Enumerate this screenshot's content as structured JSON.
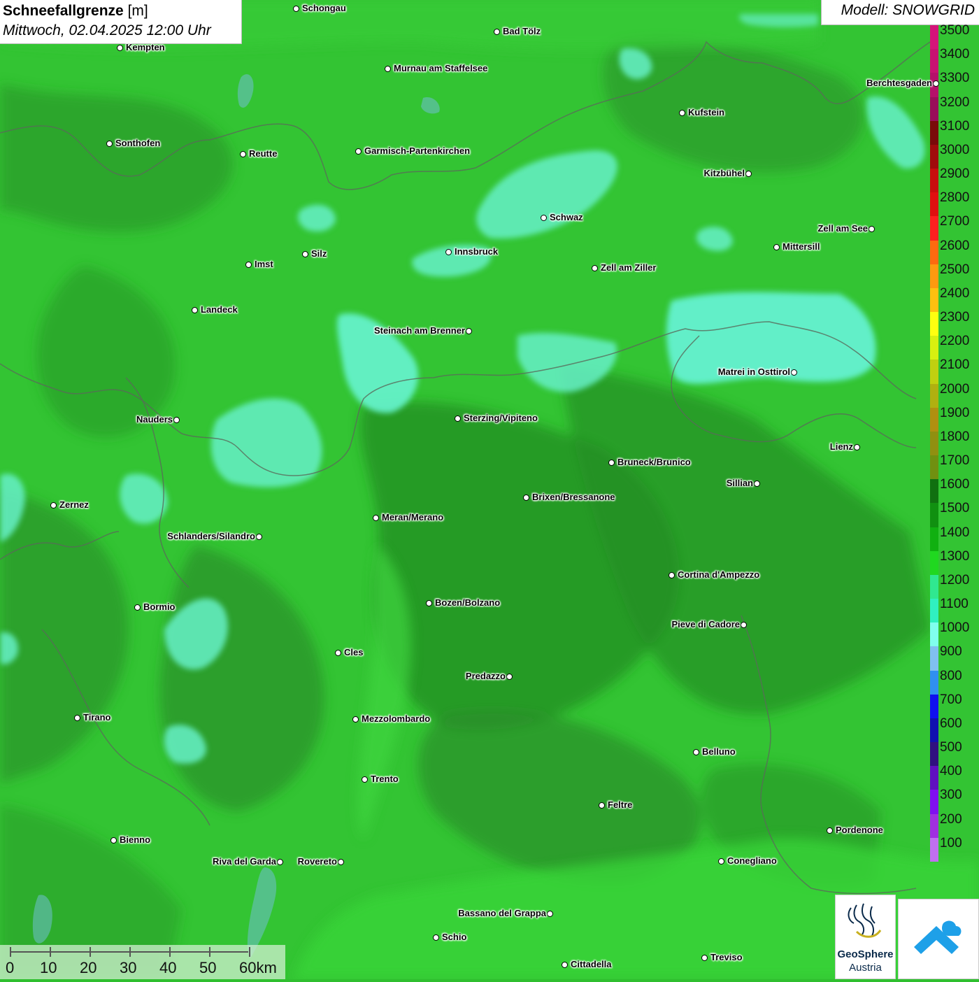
{
  "header": {
    "title_bold": "Schneefallgrenze",
    "title_unit": "[m]",
    "datetime": "Mittwoch, 02.04.2025 12:00 Uhr",
    "model": "Modell: SNOWGRID"
  },
  "legend": {
    "levels": [
      {
        "label": "3500",
        "color": "#d4147a"
      },
      {
        "label": "3400",
        "color": "#c81272"
      },
      {
        "label": "3300",
        "color": "#b5106a"
      },
      {
        "label": "3200",
        "color": "#9a0e5a"
      },
      {
        "label": "3100",
        "color": "#7a0a0a"
      },
      {
        "label": "3000",
        "color": "#a00c0c"
      },
      {
        "label": "2900",
        "color": "#c80e0e"
      },
      {
        "label": "2800",
        "color": "#e01010"
      },
      {
        "label": "2700",
        "color": "#ff2020"
      },
      {
        "label": "2600",
        "color": "#ff6a10"
      },
      {
        "label": "2500",
        "color": "#ff9a10"
      },
      {
        "label": "2400",
        "color": "#ffc010"
      },
      {
        "label": "2300",
        "color": "#ffff10"
      },
      {
        "label": "2200",
        "color": "#d8f010"
      },
      {
        "label": "2100",
        "color": "#c0d010"
      },
      {
        "label": "2000",
        "color": "#b0b010"
      },
      {
        "label": "1900",
        "color": "#b09010"
      },
      {
        "label": "1800",
        "color": "#909010"
      },
      {
        "label": "1700",
        "color": "#709010"
      },
      {
        "label": "1600",
        "color": "#107010"
      },
      {
        "label": "1500",
        "color": "#109010"
      },
      {
        "label": "1400",
        "color": "#10b010"
      },
      {
        "label": "1300",
        "color": "#20d820"
      },
      {
        "label": "1200",
        "color": "#30e890"
      },
      {
        "label": "1100",
        "color": "#30f0c0"
      },
      {
        "label": "1000",
        "color": "#80ffee"
      },
      {
        "label": "900",
        "color": "#80c0f0"
      },
      {
        "label": "800",
        "color": "#3090f0"
      },
      {
        "label": "700",
        "color": "#1010f0"
      },
      {
        "label": "600",
        "color": "#1010b0"
      },
      {
        "label": "500",
        "color": "#301080"
      },
      {
        "label": "400",
        "color": "#6010c0"
      },
      {
        "label": "300",
        "color": "#8010f0"
      },
      {
        "label": "200",
        "color": "#a030e0"
      },
      {
        "label": "100",
        "color": "#c070f0"
      }
    ]
  },
  "cities": [
    {
      "name": "Schongau",
      "side": "right"
    },
    {
      "name": "Bad Tölz",
      "side": "right"
    },
    {
      "name": "Kempten",
      "side": "right"
    },
    {
      "name": "Murnau am Staffelsee",
      "side": "right"
    },
    {
      "name": "Berchtesgaden",
      "side": "left"
    },
    {
      "name": "Kufstein",
      "side": "right"
    },
    {
      "name": "Sonthofen",
      "side": "right"
    },
    {
      "name": "Reutte",
      "side": "right"
    },
    {
      "name": "Garmisch-Partenkirchen",
      "side": "right"
    },
    {
      "name": "Kitzbühel",
      "side": "left"
    },
    {
      "name": "Schwaz",
      "side": "right"
    },
    {
      "name": "Zell am See",
      "side": "left"
    },
    {
      "name": "Mittersill",
      "side": "right"
    },
    {
      "name": "Innsbruck",
      "side": "right"
    },
    {
      "name": "Silz",
      "side": "right"
    },
    {
      "name": "Imst",
      "side": "right"
    },
    {
      "name": "Zell am Ziller",
      "side": "right"
    },
    {
      "name": "Landeck",
      "side": "right"
    },
    {
      "name": "Steinach am Brenner",
      "side": "left"
    },
    {
      "name": "Matrei in Osttirol",
      "side": "left"
    },
    {
      "name": "Nauders",
      "side": "left"
    },
    {
      "name": "Sterzing/Vipiteno",
      "side": "right"
    },
    {
      "name": "Lienz",
      "side": "left"
    },
    {
      "name": "Bruneck/Brunico",
      "side": "right"
    },
    {
      "name": "Sillian",
      "side": "left"
    },
    {
      "name": "Zernez",
      "side": "right"
    },
    {
      "name": "Brixen/Bressanone",
      "side": "right"
    },
    {
      "name": "Meran/Merano",
      "side": "right"
    },
    {
      "name": "Schlanders/Silandro",
      "side": "left"
    },
    {
      "name": "Cortina d'Ampezzo",
      "side": "right"
    },
    {
      "name": "Bozen/Bolzano",
      "side": "right"
    },
    {
      "name": "Bormio",
      "side": "right"
    },
    {
      "name": "Pieve di Cadore",
      "side": "left"
    },
    {
      "name": "Cles",
      "side": "right"
    },
    {
      "name": "Predazzo",
      "side": "left"
    },
    {
      "name": "Tirano",
      "side": "right"
    },
    {
      "name": "Mezzolombardo",
      "side": "right"
    },
    {
      "name": "Belluno",
      "side": "right"
    },
    {
      "name": "Trento",
      "side": "right"
    },
    {
      "name": "Feltre",
      "side": "right"
    },
    {
      "name": "Pordenone",
      "side": "right"
    },
    {
      "name": "Bienno",
      "side": "right"
    },
    {
      "name": "Riva del Garda",
      "side": "left"
    },
    {
      "name": "Rovereto",
      "side": "left"
    },
    {
      "name": "Conegliano",
      "side": "right"
    },
    {
      "name": "Bassano del Grappa",
      "side": "left"
    },
    {
      "name": "Schio",
      "side": "right"
    },
    {
      "name": "Treviso",
      "side": "right"
    },
    {
      "name": "Cittadella",
      "side": "right"
    }
  ],
  "scalebar": {
    "labels": [
      "0",
      "10",
      "20",
      "30",
      "40",
      "50",
      "60km"
    ]
  },
  "logos": {
    "geosphere_line1": "GeoSphere",
    "geosphere_line2": "Austria"
  }
}
